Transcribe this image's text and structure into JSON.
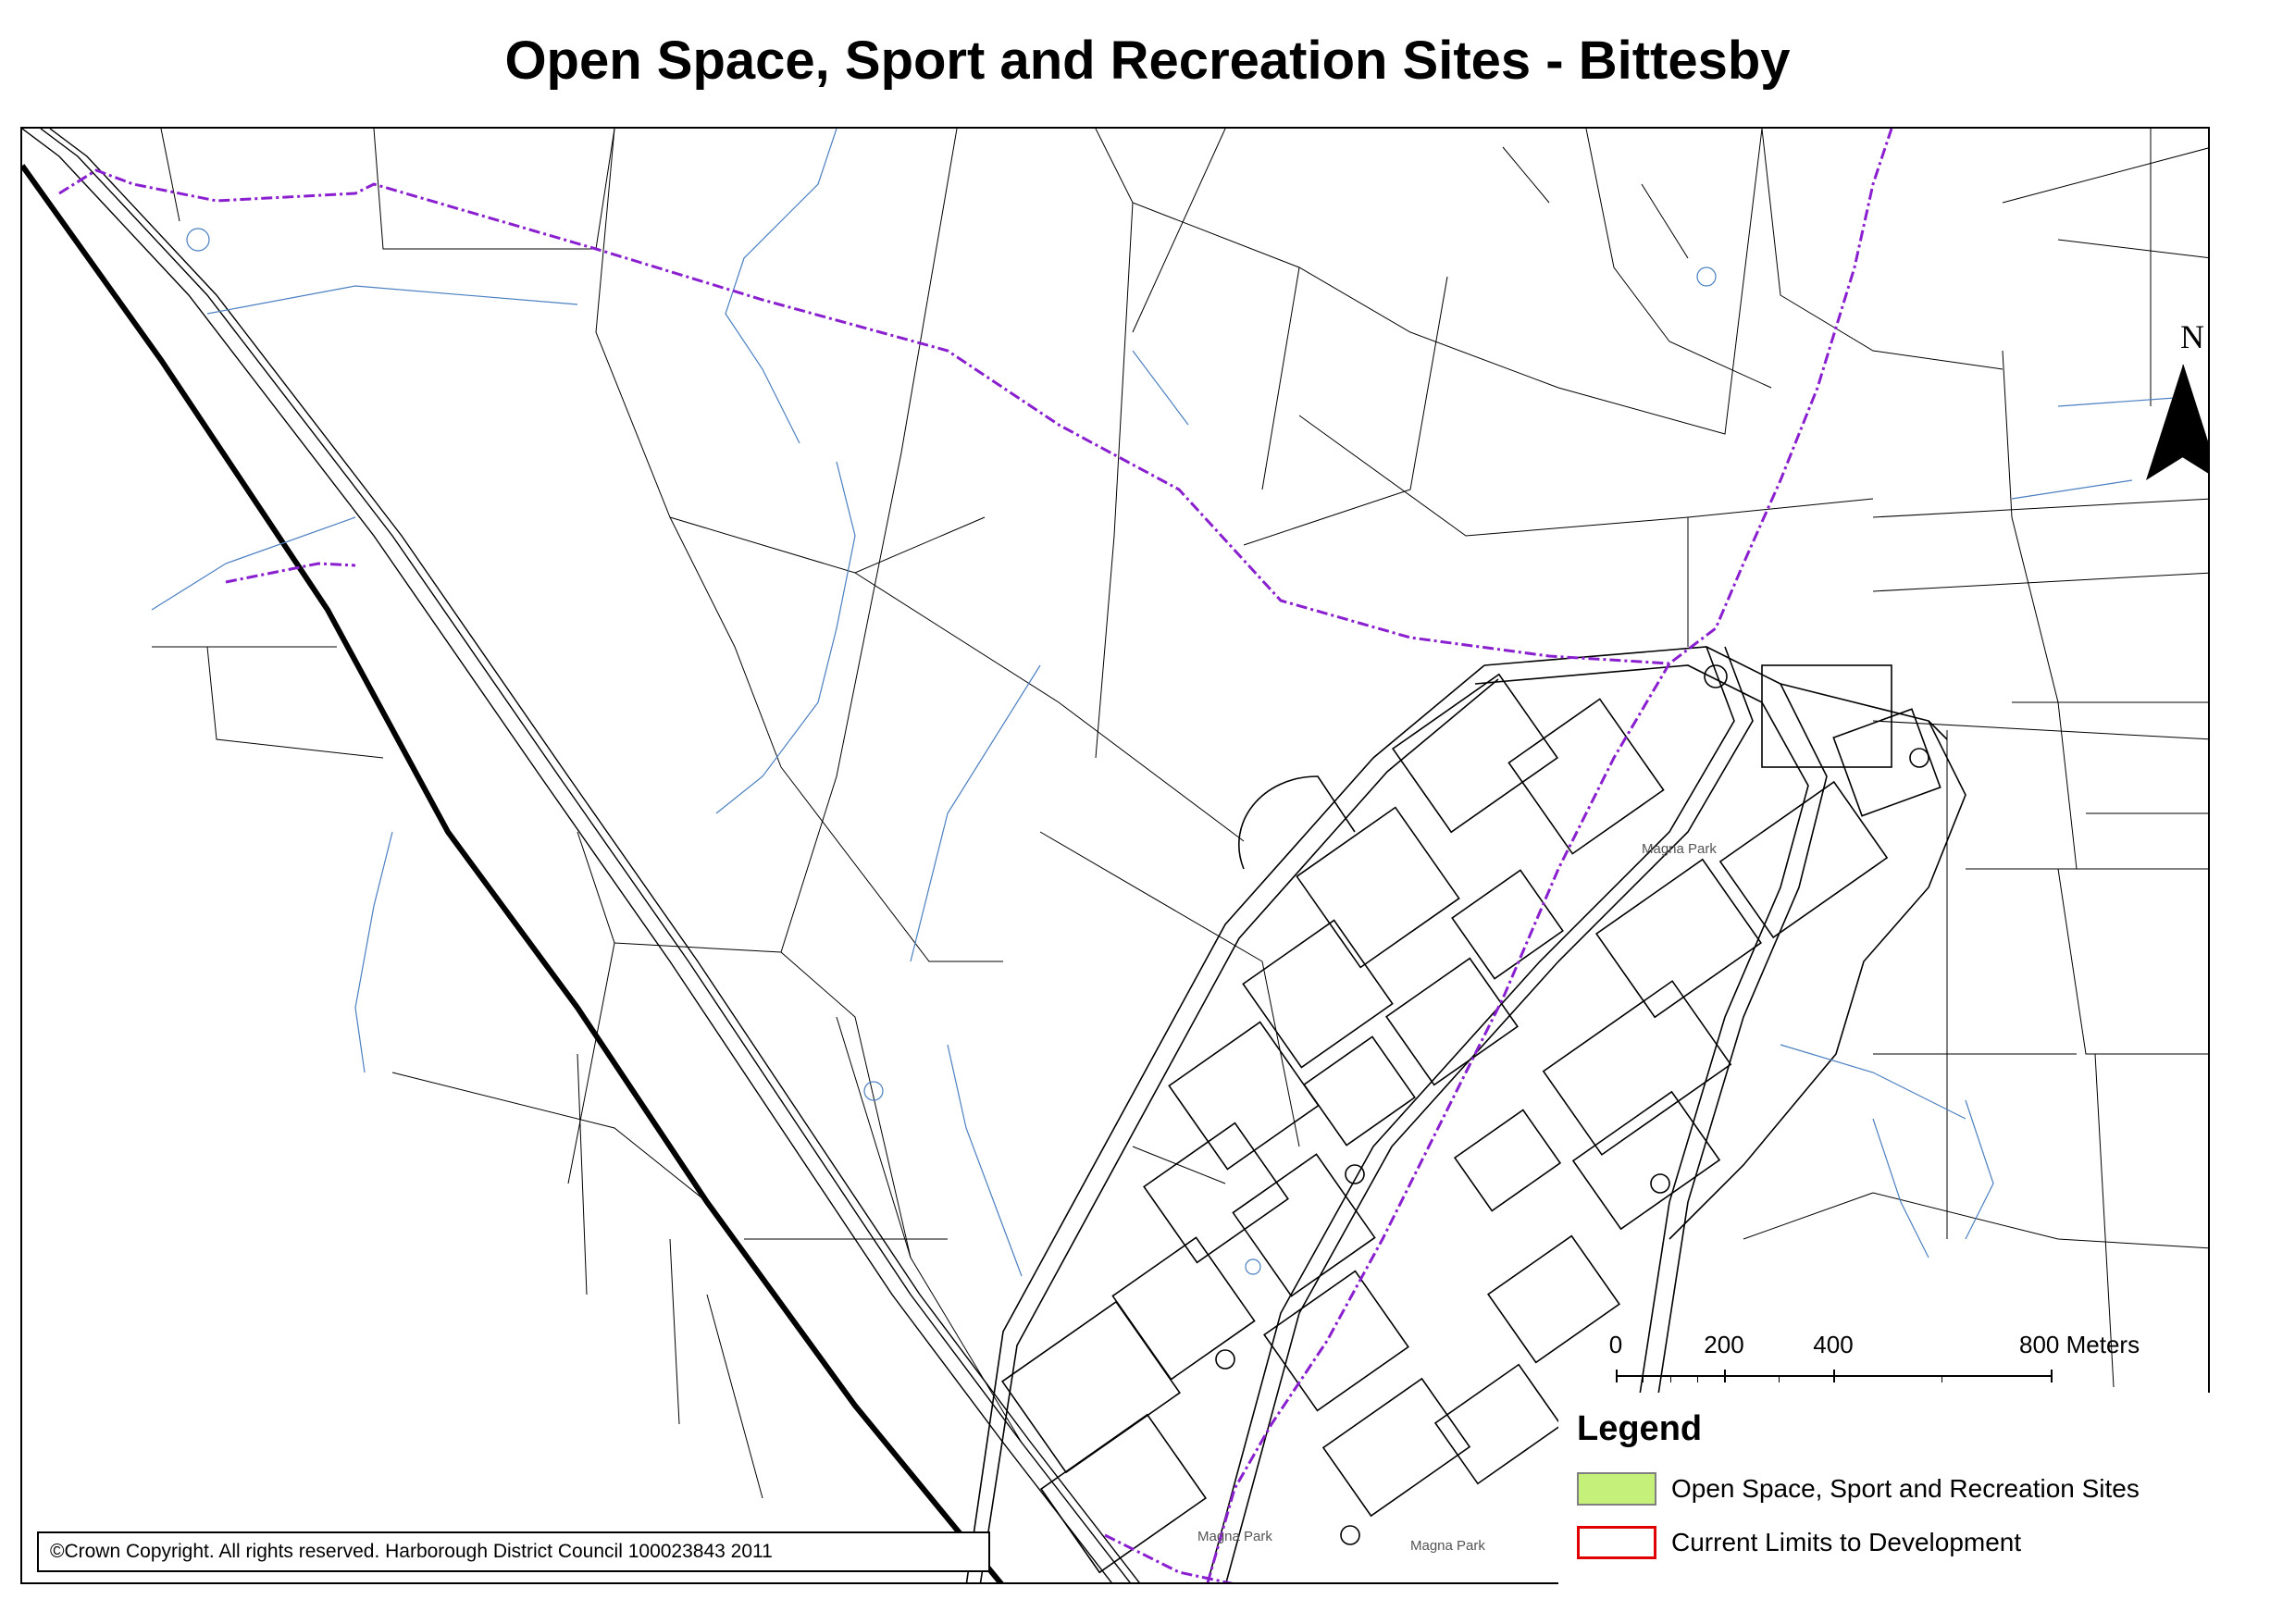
{
  "map": {
    "title": "Open Space, Sport and Recreation Sites - Bittesby",
    "north_label": "N",
    "place_labels": [
      "Magna Park",
      "Magna Park",
      "Magna Park"
    ],
    "copyright": "©Crown Copyright. All rights reserved.  Harborough District Council 100023843  2011",
    "scale": {
      "unit_label": "Meters",
      "ticks": [
        "0",
        "200",
        "400",
        "800"
      ]
    },
    "legend": {
      "title": "Legend",
      "items": [
        {
          "label": "Open Space, Sport and Recreation Sites",
          "fill": "#c5f07a",
          "stroke": "#808080"
        },
        {
          "label": "Current Limits to Development",
          "fill": "#ffffff",
          "stroke": "#e00000"
        }
      ]
    },
    "colors": {
      "parish_boundary": "#8a1fd0",
      "railway": "#000000",
      "water": "#4a7fc1",
      "roads": "#000000"
    }
  }
}
